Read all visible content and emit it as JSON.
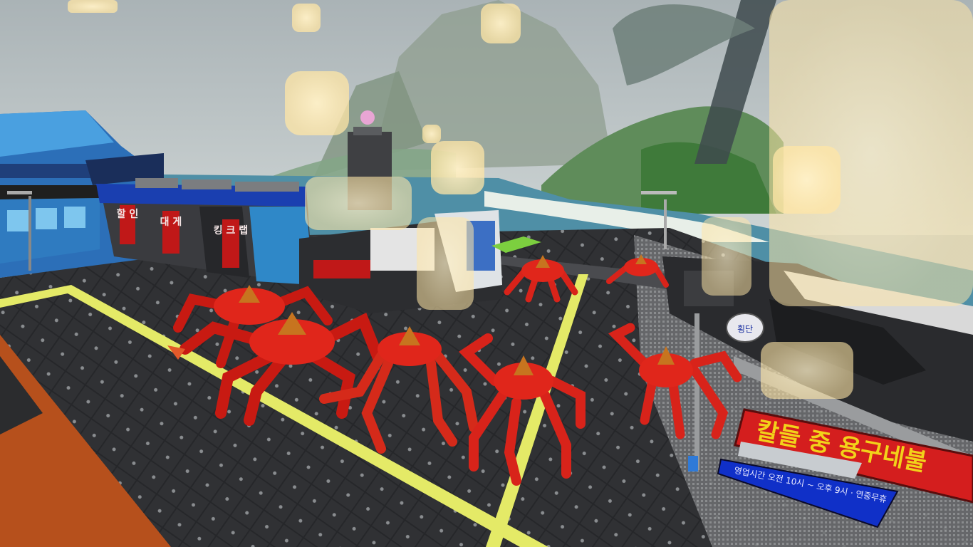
{
  "scene": {
    "red_sign_text": "칼들 중 용구네불",
    "blue_sign_text": "영업시간 오전 10시 ~ 오후 9시 · 연중무휴",
    "vertical_sign_left": "할 인",
    "vertical_sign_mid": "대 게",
    "vertical_sign_right": "킹 크 랩",
    "round_sign_text": "횡단"
  },
  "colors": {
    "sky": "#bcc5c7",
    "sea": "#4f8fa6",
    "crab": "#e0261b",
    "crab_dark": "#a6150f",
    "road": "#2a2b2e",
    "road_line": "#e4ea67",
    "red_sign": "#d41e1e",
    "blue_sign": "#1030c8"
  }
}
